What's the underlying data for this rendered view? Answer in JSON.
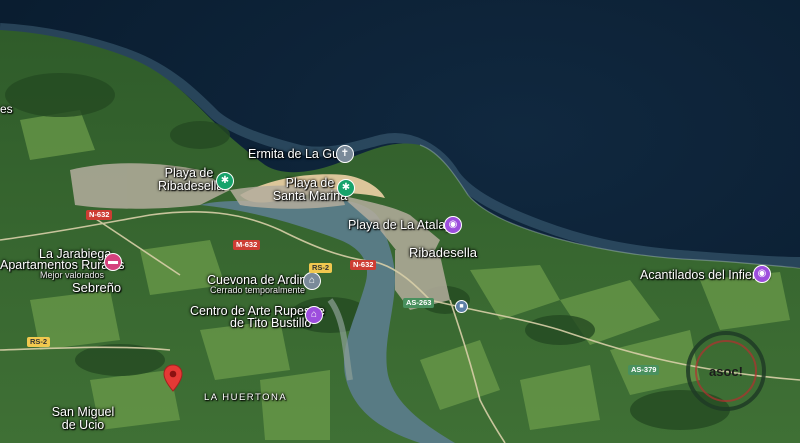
{
  "places": {
    "ermita": "Ermita de La Guía",
    "playa_ribadesella_1": "Playa de",
    "playa_ribadesella_2": "Ribadesella",
    "playa_santa_marina_1": "Playa de",
    "playa_santa_marina_2": "Santa Marina",
    "playa_atalaya": "Playa de La Atalaya",
    "ribadesella": "Ribadesella",
    "acantilados": "Acantilados del Infierno",
    "jarabiega_1": "La Jarabiega",
    "jarabiega_2": "Apartamentos Rurales",
    "jarabiega_3": "Mejor valorados",
    "sebreno": "Sebreño",
    "cuevona_1": "Cuevona de Ardines",
    "cuevona_2": "Cerrado temporalmente",
    "centro_arte_1": "Centro de Arte Rupestre",
    "centro_arte_2": "de Tito Bustillo",
    "huertona": "LA HUERTONA",
    "san_miguel_1": "San Miguel",
    "san_miguel_2": "de Ucio",
    "edge_label": "es"
  },
  "roads": {
    "n632_a": "N-632",
    "n632_b": "M-632",
    "n632_c": "N-632",
    "rs2": "RS-2",
    "as263": "AS-263",
    "as379_a": "AS-379",
    "as379_b": "AS-379",
    "rs2_small": "RS-2"
  },
  "poi_icons": {
    "chapel": "cross-icon",
    "beach": "beach-icon",
    "camera": "camera-icon",
    "hotel": "bed-icon",
    "museum": "museum-icon",
    "selected": "red-location-pin-icon"
  },
  "watermark": {
    "text": "asoc!"
  },
  "colors": {
    "sea_deep": "#0d2338",
    "sea_near": "#17405a",
    "land": "#3f6e34",
    "field": "#6a9a48",
    "urban": "#b7b1a2",
    "sand": "#dcc69a",
    "river": "#5d7d86",
    "poi_green": "#17a36b",
    "poi_purple": "#9d4edd",
    "poi_pink": "#d5427d",
    "poi_grey": "#7a8a99",
    "pin_red": "#e53935"
  }
}
